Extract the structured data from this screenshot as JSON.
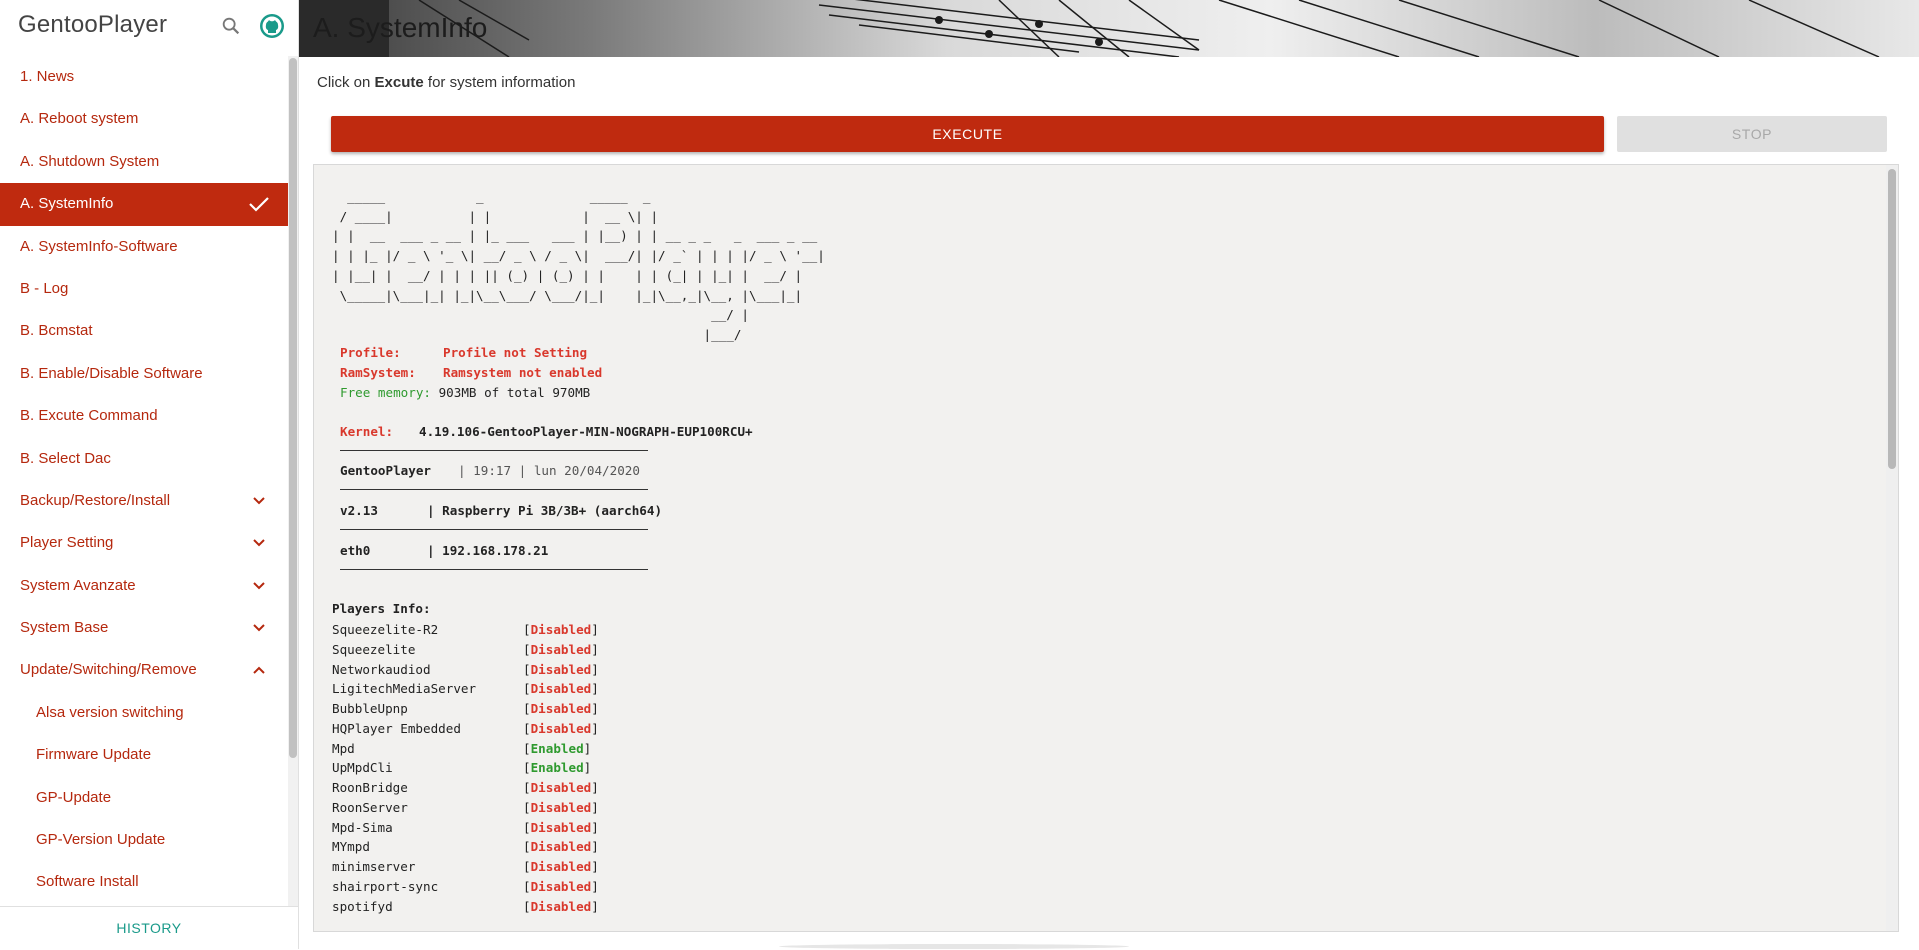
{
  "app": {
    "title": "GentooPlayer"
  },
  "sidebar": {
    "items": [
      {
        "label": "1. News",
        "sub": false,
        "active": false,
        "expander": ""
      },
      {
        "label": "A. Reboot system",
        "sub": false,
        "active": false,
        "expander": ""
      },
      {
        "label": "A. Shutdown System",
        "sub": false,
        "active": false,
        "expander": ""
      },
      {
        "label": "A. SystemInfo",
        "sub": false,
        "active": true,
        "expander": "check"
      },
      {
        "label": "A. SystemInfo-Software",
        "sub": false,
        "active": false,
        "expander": ""
      },
      {
        "label": "B - Log",
        "sub": false,
        "active": false,
        "expander": ""
      },
      {
        "label": "B. Bcmstat",
        "sub": false,
        "active": false,
        "expander": ""
      },
      {
        "label": "B. Enable/Disable Software",
        "sub": false,
        "active": false,
        "expander": ""
      },
      {
        "label": "B. Excute Command",
        "sub": false,
        "active": false,
        "expander": ""
      },
      {
        "label": "B. Select Dac",
        "sub": false,
        "active": false,
        "expander": ""
      },
      {
        "label": "Backup/Restore/Install",
        "sub": false,
        "active": false,
        "expander": "down"
      },
      {
        "label": "Player Setting",
        "sub": false,
        "active": false,
        "expander": "down"
      },
      {
        "label": "System Avanzate",
        "sub": false,
        "active": false,
        "expander": "down"
      },
      {
        "label": "System Base",
        "sub": false,
        "active": false,
        "expander": "down"
      },
      {
        "label": "Update/Switching/Remove",
        "sub": false,
        "active": false,
        "expander": "up"
      },
      {
        "label": "Alsa version switching",
        "sub": true,
        "active": false,
        "expander": ""
      },
      {
        "label": "Firmware Update",
        "sub": true,
        "active": false,
        "expander": ""
      },
      {
        "label": "GP-Update",
        "sub": true,
        "active": false,
        "expander": ""
      },
      {
        "label": "GP-Version Update",
        "sub": true,
        "active": false,
        "expander": ""
      },
      {
        "label": "Software Install",
        "sub": true,
        "active": false,
        "expander": ""
      }
    ],
    "history_label": "HISTORY"
  },
  "header": {
    "title": "A. SystemInfo"
  },
  "hint": {
    "prefix": "Click on ",
    "keyword": "Excute",
    "suffix": " for system information"
  },
  "buttons": {
    "execute": "EXECUTE",
    "stop": "STOP"
  },
  "console": {
    "ascii_art": "  _____            _              _____  _\n / ____|          | |            |  __ \\| |\n| |  __  ___ _ __ | |_ ___   ___ | |__) | | __ _ _   _  ___ _ __\n| | |_ |/ _ \\ '_ \\| __/ _ \\ / _ \\|  ___/| |/ _` | | | |/ _ \\ '__|\n| |__| |  __/ | | | || (_) | (_) | |    | | (_| | |_| |  __/ |\n \\_____|\\___|_| |_|\\__\\___/ \\___/|_|    |_|\\__,_|\\__, |\\___|_|\n                                                  __/ |\n                                                 |___/",
    "profile_label": "Profile:",
    "profile_value": "Profile not Setting",
    "ramsystem_label": "RamSystem:",
    "ramsystem_value": "Ramsystem not enabled",
    "free_memory_label": "Free memory:",
    "free_memory_value": "903MB of total 970MB",
    "kernel_label": "Kernel:",
    "kernel_value": "4.19.106-GentooPlayer-MIN-NOGRAPH-EUP100RCU+",
    "host_name": "GentooPlayer",
    "host_time": "| 19:17 | lun 20/04/2020",
    "version": "v2.13",
    "hardware": "| Raspberry Pi 3B/3B+ (aarch64)",
    "iface": "eth0",
    "ip": "| 192.168.178.21",
    "players_title": "Players Info:",
    "players": [
      {
        "name": "Squeezelite-R2",
        "status": "Disabled"
      },
      {
        "name": "Squeezelite",
        "status": "Disabled"
      },
      {
        "name": "Networkaudiod",
        "status": "Disabled"
      },
      {
        "name": "LigitechMediaServer",
        "status": "Disabled"
      },
      {
        "name": "BubbleUpnp",
        "status": "Disabled"
      },
      {
        "name": "HQPlayer Embedded",
        "status": "Disabled"
      },
      {
        "name": "Mpd",
        "status": "Enabled"
      },
      {
        "name": "UpMpdCli",
        "status": "Enabled"
      },
      {
        "name": "RoonBridge",
        "status": "Disabled"
      },
      {
        "name": "RoonServer",
        "status": "Disabled"
      },
      {
        "name": "Mpd-Sima",
        "status": "Disabled"
      },
      {
        "name": "MYmpd",
        "status": "Disabled"
      },
      {
        "name": "minimserver",
        "status": "Disabled"
      },
      {
        "name": "shairport-sync",
        "status": "Disabled"
      },
      {
        "name": "spotifyd",
        "status": "Disabled"
      }
    ]
  },
  "colors": {
    "accent": "#bf2a0f",
    "link": "#b5280e",
    "history": "#1a9a8a",
    "disabled": "#d9382c",
    "enabled": "#2f9a2f"
  }
}
